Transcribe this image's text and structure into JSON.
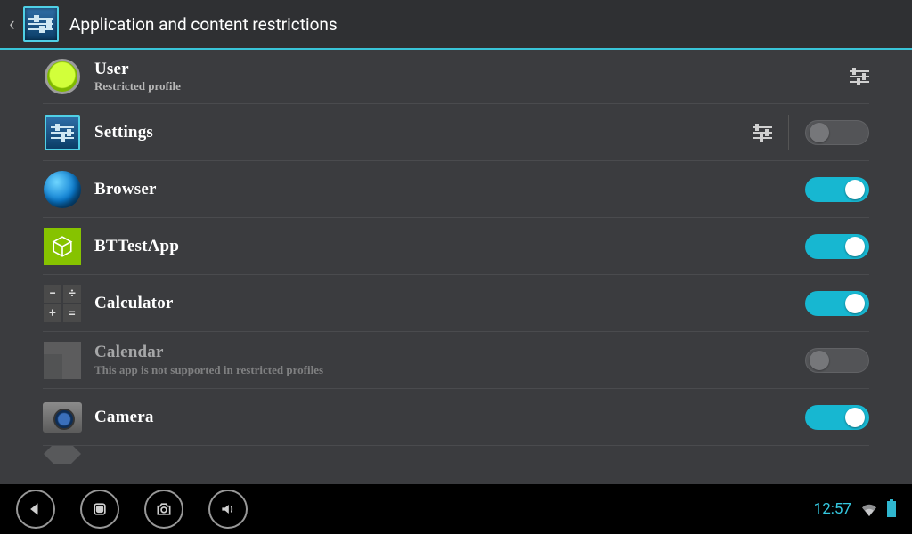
{
  "header": {
    "title": "Application and content restrictions"
  },
  "user": {
    "name": "User",
    "subtitle": "Restricted profile"
  },
  "apps": [
    {
      "id": "settings",
      "name": "Settings",
      "icon": "settings",
      "has_tune": true,
      "toggle": "off",
      "disabled": false
    },
    {
      "id": "browser",
      "name": "Browser",
      "icon": "browser",
      "has_tune": false,
      "toggle": "on",
      "disabled": false
    },
    {
      "id": "bttestapp",
      "name": "BTTestApp",
      "icon": "bt",
      "has_tune": false,
      "toggle": "on",
      "disabled": false
    },
    {
      "id": "calculator",
      "name": "Calculator",
      "icon": "calc",
      "has_tune": false,
      "toggle": "on",
      "disabled": false
    },
    {
      "id": "calendar",
      "name": "Calendar",
      "icon": "calendar",
      "has_tune": false,
      "toggle": "off",
      "disabled": true,
      "subtitle": "This app is not supported in restricted profiles"
    },
    {
      "id": "camera",
      "name": "Camera",
      "icon": "camera",
      "has_tune": false,
      "toggle": "on",
      "disabled": false
    }
  ],
  "status": {
    "time": "12:57"
  },
  "colors": {
    "accent": "#17b7d1",
    "header_divider": "#39c4d8",
    "background": "#3b3c3f"
  }
}
